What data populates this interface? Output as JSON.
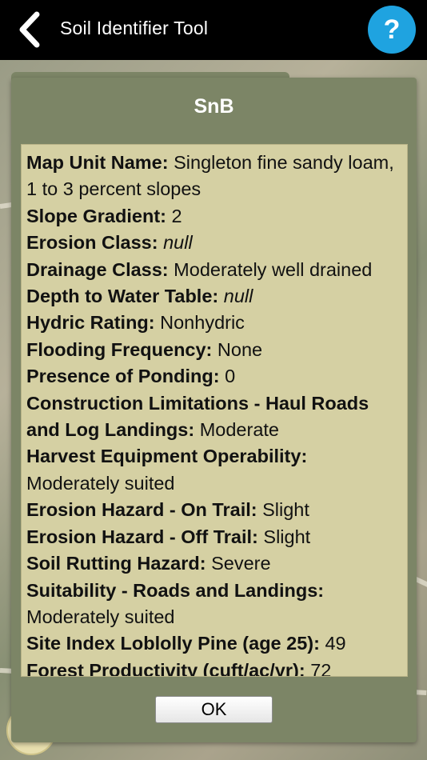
{
  "app_bar": {
    "title": "Soil Identifier Tool",
    "back_icon": "chevron-left-icon",
    "help_label": "?",
    "help_color": "#1fa3e0"
  },
  "dialog": {
    "title": "SnB",
    "ok_label": "OK",
    "background_color": "#7c8566",
    "content_color": "#d5d0a3",
    "fields": [
      {
        "label": "Map Unit Name:",
        "value": "Singleton fine sandy loam, 1 to 3 percent slopes"
      },
      {
        "label": "Slope Gradient:",
        "value": "2"
      },
      {
        "label": "Erosion Class:",
        "value": "null"
      },
      {
        "label": "Drainage Class:",
        "value": "Moderately well drained"
      },
      {
        "label": "Depth to Water Table:",
        "value": "null"
      },
      {
        "label": "Hydric Rating:",
        "value": "Nonhydric"
      },
      {
        "label": "Flooding Frequency:",
        "value": "None"
      },
      {
        "label": "Presence of Ponding:",
        "value": "0"
      },
      {
        "label": "Construction Limitations - Haul Roads and Log Landings:",
        "value": "Moderate"
      },
      {
        "label": "Harvest Equipment Operability:",
        "value": "Moderately suited"
      },
      {
        "label": "Erosion Hazard - On Trail:",
        "value": "Slight"
      },
      {
        "label": "Erosion Hazard - Off Trail:",
        "value": "Slight"
      },
      {
        "label": "Soil Rutting Hazard:",
        "value": "Severe"
      },
      {
        "label": "Suitability - Roads and Landings:",
        "value": "Moderately suited"
      },
      {
        "label": "Site Index Loblolly Pine (age 25):",
        "value": "49"
      },
      {
        "label": "Forest Productivity (cuft/ac/yr):",
        "value": "72"
      }
    ]
  }
}
